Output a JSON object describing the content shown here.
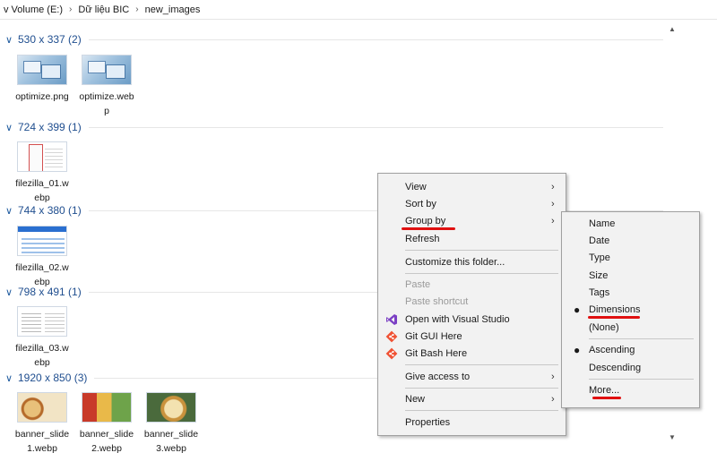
{
  "breadcrumb": {
    "items": [
      "v Volume (E:)",
      "Dữ liệu BIC",
      "new_images"
    ],
    "separator": "›"
  },
  "groups": [
    {
      "title": "530 x 337 (2)",
      "files": [
        {
          "name": "optimize.png",
          "icon": "optimize-thumbnail"
        },
        {
          "name": "optimize.webp",
          "icon": "optimize-thumbnail"
        }
      ]
    },
    {
      "title": "724 x 399 (1)",
      "files": [
        {
          "name": "filezilla_01.webp",
          "icon": "filezilla-thumbnail"
        }
      ]
    },
    {
      "title": "744 x 380 (1)",
      "files": [
        {
          "name": "filezilla_02.webp",
          "icon": "filezilla-thumbnail"
        }
      ]
    },
    {
      "title": "798 x 491 (1)",
      "files": [
        {
          "name": "filezilla_03.webp",
          "icon": "filezilla-thumbnail"
        }
      ]
    },
    {
      "title": "1920 x 850 (3)",
      "files": [
        {
          "name": "banner_slide1.webp",
          "icon": "food-thumbnail"
        },
        {
          "name": "banner_slide2.webp",
          "icon": "food-thumbnail"
        },
        {
          "name": "banner_slide3.webp",
          "icon": "food-thumbnail"
        }
      ]
    }
  ],
  "context_menu": {
    "items": [
      {
        "label": "View",
        "submenu": true,
        "enabled": true
      },
      {
        "label": "Sort by",
        "submenu": true,
        "enabled": true
      },
      {
        "label": "Group by",
        "submenu": true,
        "enabled": true,
        "highlighted": true
      },
      {
        "label": "Refresh",
        "enabled": true
      },
      {
        "label": "Customize this folder...",
        "enabled": true
      },
      {
        "label": "Paste",
        "enabled": false
      },
      {
        "label": "Paste shortcut",
        "enabled": false
      },
      {
        "label": "Open with Visual Studio",
        "enabled": true,
        "icon": "visual-studio-icon"
      },
      {
        "label": "Git GUI Here",
        "enabled": true,
        "icon": "git-icon"
      },
      {
        "label": "Git Bash Here",
        "enabled": true,
        "icon": "git-icon"
      },
      {
        "label": "Give access to",
        "submenu": true,
        "enabled": true
      },
      {
        "label": "New",
        "submenu": true,
        "enabled": true
      },
      {
        "label": "Properties",
        "enabled": true
      }
    ]
  },
  "group_by_submenu": {
    "items": [
      {
        "label": "Name"
      },
      {
        "label": "Date"
      },
      {
        "label": "Type"
      },
      {
        "label": "Size"
      },
      {
        "label": "Tags"
      },
      {
        "label": "Dimensions",
        "selected": true
      },
      {
        "label": "(None)"
      },
      {
        "label": "Ascending",
        "selected": true
      },
      {
        "label": "Descending"
      },
      {
        "label": "More..."
      }
    ]
  },
  "colors": {
    "group_header": "#1f4e8f",
    "annotation_red": "#e01010",
    "menu_bg": "#f2f2f2",
    "disabled_text": "#9a9a9a"
  }
}
